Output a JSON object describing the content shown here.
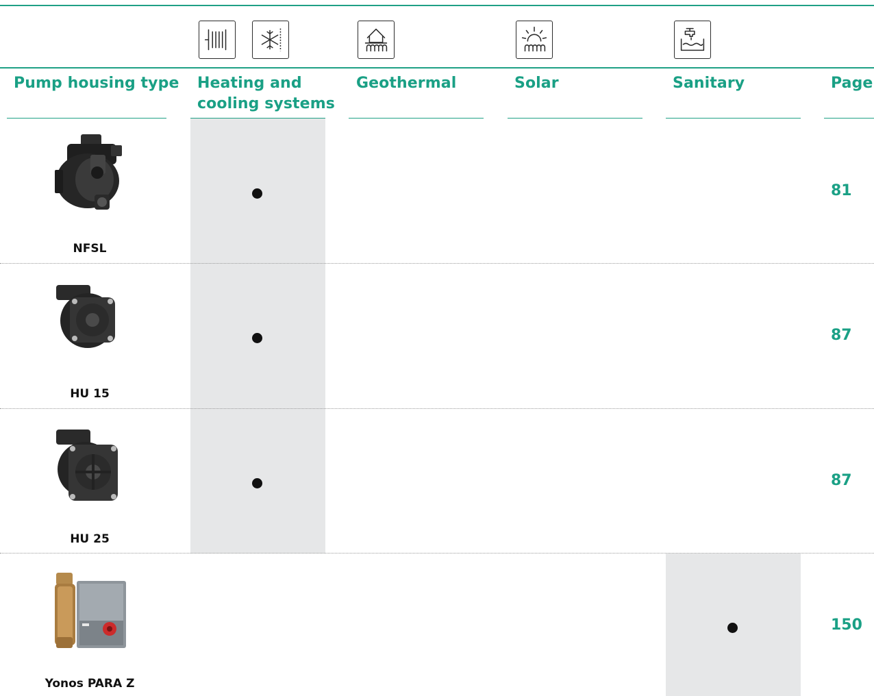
{
  "header": {
    "icons": [
      "radiator-icon",
      "snowflake-icon",
      "geothermal-house-icon",
      "solar-icon",
      "sanitary-tap-icon"
    ],
    "columns": [
      {
        "key": "type",
        "line1": "Pump housing type",
        "line2": ""
      },
      {
        "key": "heating",
        "line1": "Heating and",
        "line2": "cooling systems"
      },
      {
        "key": "geothermal",
        "line1": "Geothermal",
        "line2": ""
      },
      {
        "key": "solar",
        "line1": "Solar",
        "line2": ""
      },
      {
        "key": "sanitary",
        "line1": "Sanitary",
        "line2": ""
      },
      {
        "key": "page",
        "line1": "Page",
        "line2": ""
      }
    ]
  },
  "rows": [
    {
      "name": "NFSL",
      "heating": true,
      "geothermal": false,
      "solar": false,
      "sanitary": false,
      "page": "81"
    },
    {
      "name": "HU 15",
      "heating": true,
      "geothermal": false,
      "solar": false,
      "sanitary": false,
      "page": "87"
    },
    {
      "name": "HU 25",
      "heating": true,
      "geothermal": false,
      "solar": false,
      "sanitary": false,
      "page": "87"
    },
    {
      "name": "Yonos PARA Z",
      "heating": false,
      "geothermal": false,
      "solar": false,
      "sanitary": true,
      "page": "150"
    }
  ],
  "colors": {
    "accent": "#1fa085",
    "shade": "#e6e7e8",
    "text": "#111111"
  }
}
